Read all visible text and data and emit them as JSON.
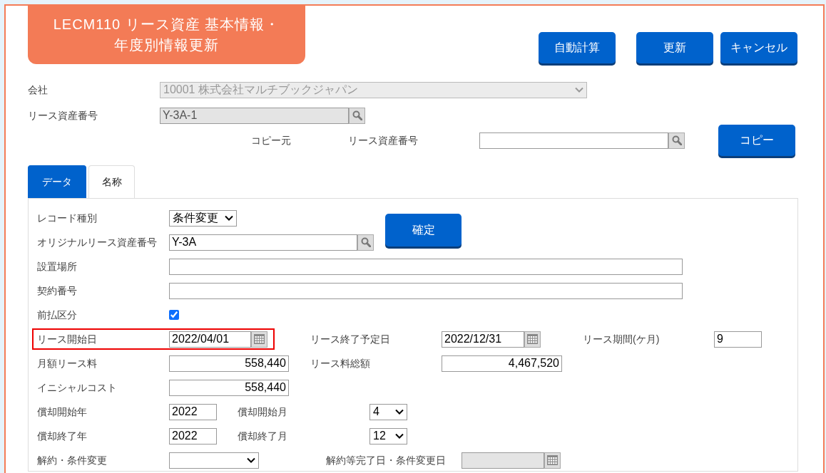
{
  "title": [
    "LECM110 リース資産 基本情報・",
    "年度別情報更新"
  ],
  "header_buttons": [
    "自動計算",
    "更新",
    "キャンセル"
  ],
  "company": {
    "label": "会社",
    "field": {
      "kind": "select",
      "value": "10001 株式会社マルチブックジャパン",
      "disabled": true
    }
  },
  "asset_number": {
    "label": "リース資産番号",
    "field": {
      "kind": "lookup",
      "value": "Y-3A-1",
      "disabled": true
    }
  },
  "copy_source": {
    "label": "コピー元",
    "field_label": "リース資産番号",
    "field": {
      "kind": "lookup",
      "disabled": false
    },
    "button": "コピー"
  },
  "tabs": [
    {
      "label": "データ",
      "selected": true
    },
    {
      "label": "名称",
      "selected": false
    }
  ],
  "rows": [
    [
      {
        "kind": "label",
        "text": "レコード種別"
      },
      {
        "kind": "select",
        "value": "条件変更",
        "disabled": false
      },
      {
        "kind": "button",
        "text": "確定"
      }
    ],
    [
      {
        "kind": "label",
        "text": "オリジナルリース資産番号"
      },
      {
        "kind": "lookup",
        "value": "Y-3A",
        "disabled": false
      }
    ],
    [
      {
        "kind": "label",
        "text": "設置場所"
      },
      {
        "kind": "text",
        "disabled": false
      }
    ],
    [
      {
        "kind": "label",
        "text": "契約番号"
      },
      {
        "kind": "text",
        "disabled": false
      }
    ],
    [
      {
        "kind": "label",
        "text": "前払区分"
      },
      {
        "kind": "checkbox",
        "checked": true
      }
    ],
    [
      {
        "kind": "group",
        "highlighted": true,
        "items": [
          {
            "kind": "label",
            "text": "リース開始日"
          },
          {
            "kind": "date",
            "value": "2022/04/01",
            "disabled": false
          }
        ]
      },
      {
        "kind": "label",
        "text": "リース終了予定日"
      },
      {
        "kind": "date",
        "value": "2022/12/31",
        "disabled": false
      },
      {
        "kind": "label",
        "text": "リース期間(ケ月)"
      },
      {
        "kind": "text",
        "value": "9",
        "disabled": false
      }
    ],
    [
      {
        "kind": "label",
        "text": "月額リース料"
      },
      {
        "kind": "number",
        "value": "558,440",
        "disabled": false
      },
      {
        "kind": "label",
        "text": "リース料総額"
      },
      {
        "kind": "number",
        "value": "4,467,520",
        "disabled": false
      }
    ],
    [
      {
        "kind": "label",
        "text": "イニシャルコスト"
      },
      {
        "kind": "number",
        "value": "558,440",
        "disabled": false
      }
    ],
    [
      {
        "kind": "label",
        "text": "償却開始年"
      },
      {
        "kind": "text",
        "value": "2022",
        "disabled": false
      },
      {
        "kind": "label",
        "text": "償却開始月"
      },
      {
        "kind": "select",
        "value": "4",
        "disabled": false
      }
    ],
    [
      {
        "kind": "label",
        "text": "償却終了年"
      },
      {
        "kind": "text",
        "value": "2022",
        "disabled": false
      },
      {
        "kind": "label",
        "text": "償却終了月"
      },
      {
        "kind": "select",
        "value": "12",
        "disabled": false
      }
    ],
    [
      {
        "kind": "label",
        "text": "解約・条件変更"
      },
      {
        "kind": "select",
        "disabled": false
      },
      {
        "kind": "label",
        "text": "解約等完了日・条件変更日"
      },
      {
        "kind": "date",
        "disabled": true
      }
    ]
  ]
}
